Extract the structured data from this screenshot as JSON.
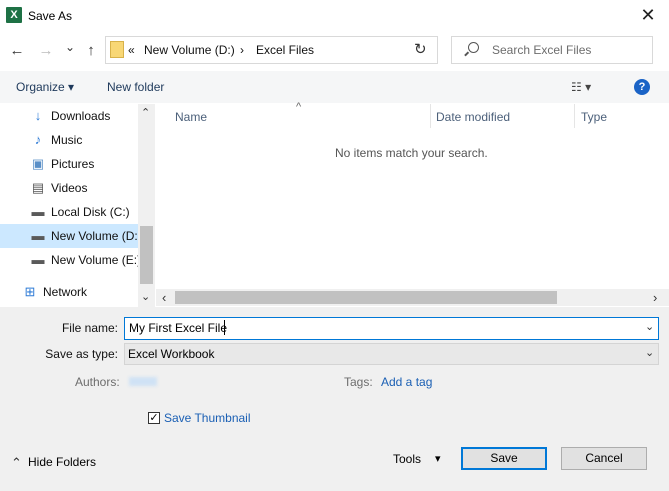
{
  "window": {
    "app_icon": "X",
    "title": "Save As",
    "close_glyph": "✕"
  },
  "nav": {
    "back_glyph": "←",
    "forward_glyph": "→",
    "dropdown_glyph": "⌄",
    "up_glyph": "↑",
    "breadcrumb_overflow": "«",
    "breadcrumb": [
      "New Volume (D:)",
      "Excel Files"
    ],
    "breadcrumb_sep": "›",
    "refresh_glyph": "↻",
    "search_placeholder": "Search Excel Files"
  },
  "toolbar": {
    "organize": "Organize ▾",
    "new_folder": "New folder",
    "view_glyph": "☷ ▾",
    "help": "?"
  },
  "sidebar": {
    "items": [
      {
        "label": "Downloads",
        "icon": "↓",
        "icon_name": "downloads-icon",
        "color": "#2e7bd6"
      },
      {
        "label": "Music",
        "icon": "♪",
        "icon_name": "music-icon",
        "color": "#2e7bd6"
      },
      {
        "label": "Pictures",
        "icon": "▣",
        "icon_name": "pictures-icon",
        "color": "#5a8fc7"
      },
      {
        "label": "Videos",
        "icon": "▤",
        "icon_name": "videos-icon",
        "color": "#555555"
      },
      {
        "label": "Local Disk (C:)",
        "icon": "▬",
        "icon_name": "local-disk-icon",
        "color": "#5a5a5a"
      },
      {
        "label": "New Volume (D:",
        "icon": "▬",
        "icon_name": "drive-d-icon",
        "color": "#5a5a5a"
      },
      {
        "label": "New Volume (E:)",
        "icon": "▬",
        "icon_name": "drive-e-icon",
        "color": "#5a5a5a"
      },
      {
        "label": "Network",
        "icon": "⊞",
        "icon_name": "network-icon",
        "color": "#2e7bd6"
      }
    ],
    "selected_index": 5,
    "scroll_up": "⌃",
    "scroll_down": "⌄"
  },
  "content": {
    "sort_arrow": "^",
    "columns": [
      "Name",
      "Date modified",
      "Type"
    ],
    "empty_message": "No items match your search.",
    "scroll_left": "‹",
    "scroll_right": "›"
  },
  "form": {
    "file_name_label": "File name:",
    "file_name_value": "My First Excel File",
    "save_as_type_label": "Save as type:",
    "save_as_type_value": "Excel Workbook",
    "authors_label": "Authors:",
    "tags_label": "Tags:",
    "tags_link": "Add a tag",
    "thumbnail_label": "Save Thumbnail",
    "thumbnail_checked": "✓",
    "dropdown_chev": "⌄"
  },
  "footer": {
    "hide_folders": "Hide Folders",
    "hide_glyph": "⌃",
    "tools": "Tools",
    "tools_glyph": "▾",
    "save": "Save",
    "cancel": "Cancel"
  }
}
